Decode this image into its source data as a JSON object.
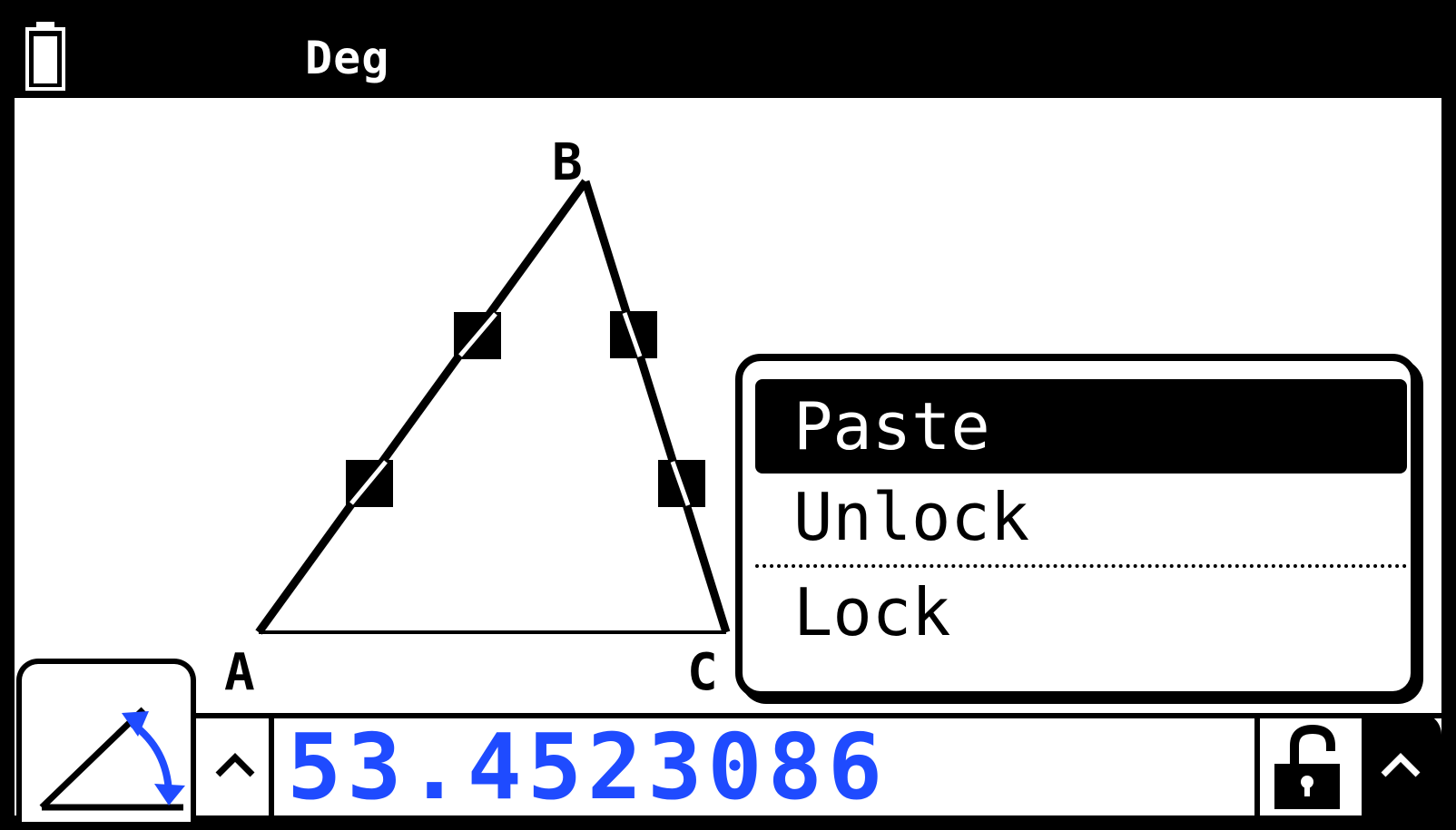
{
  "status_bar": {
    "angle_mode": "Deg",
    "battery_icon": "battery-icon"
  },
  "geometry": {
    "vertices": {
      "a": "A",
      "b": "B",
      "c": "C"
    }
  },
  "context_menu": {
    "items": [
      {
        "label": "Paste",
        "selected": true
      },
      {
        "label": "Unlock",
        "selected": false
      },
      {
        "label": "Lock",
        "selected": false
      }
    ]
  },
  "measurement_bar": {
    "value": "53.4523086",
    "tool_icon": "angle-measure-icon",
    "lock_icon": "unlocked-padlock-icon",
    "expand_icon": "caret-up-icon"
  },
  "colors": {
    "value_text": "#1f4bff",
    "background": "#ffffff",
    "foreground": "#000000"
  }
}
